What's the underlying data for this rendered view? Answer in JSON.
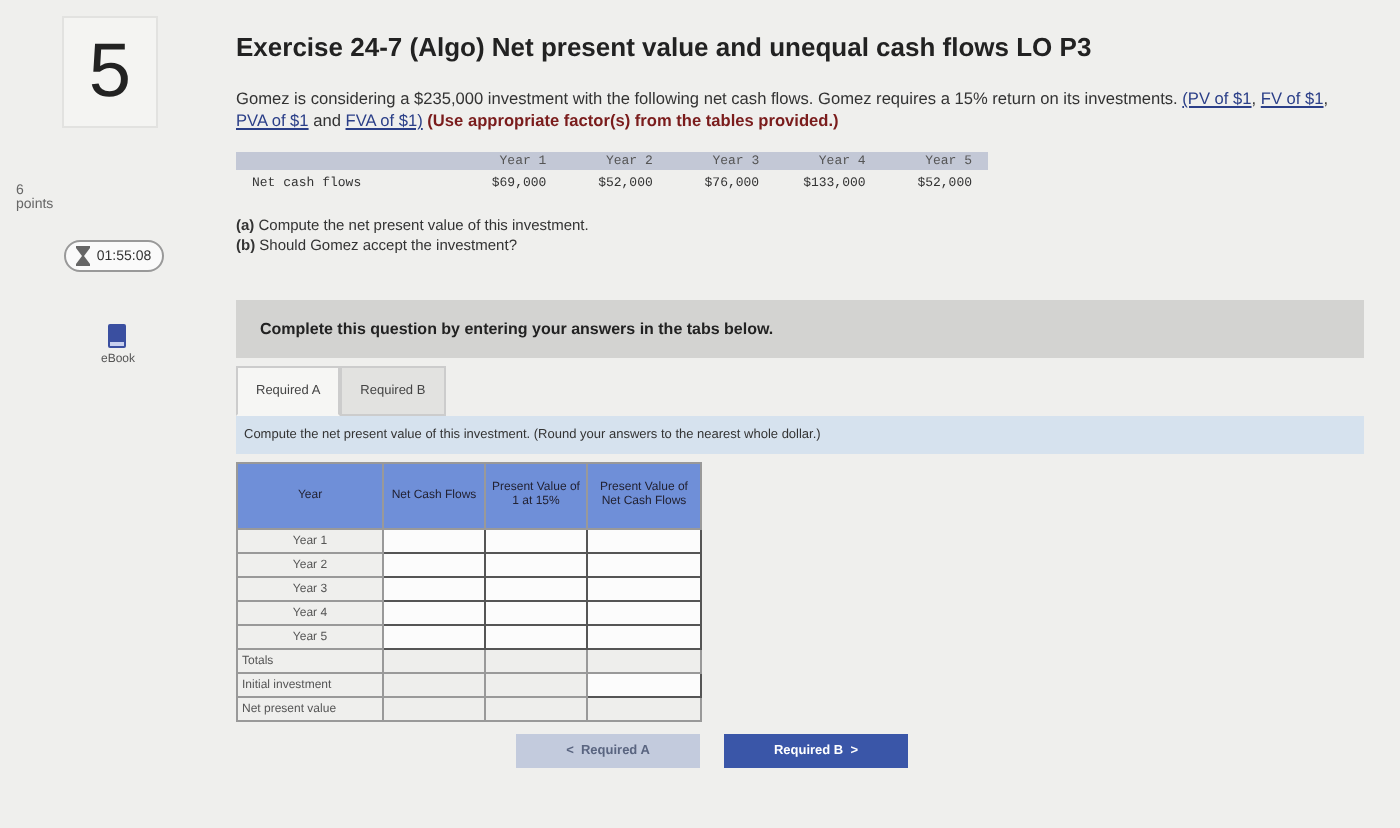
{
  "question": {
    "number": "5",
    "points_value": "6",
    "points_label": "points",
    "timer": "01:55:08",
    "ebook_label": "eBook"
  },
  "title": "Exercise 24-7 (Algo) Net present value and unequal cash flows LO P3",
  "intro": {
    "text": "Gomez is considering a $235,000 investment with the following net cash flows. Gomez requires a 15% return on its investments.",
    "links": [
      "PV of $1",
      "FV of $1",
      "PVA of $1",
      "FVA of $1"
    ],
    "link_sep": ", ",
    "last_sep": " and ",
    "open": "(",
    "close": ")",
    "note": "(Use appropriate factor(s) from the tables provided.)"
  },
  "cash_flows": {
    "row_label": "Net cash flows",
    "years": [
      "Year 1",
      "Year 2",
      "Year 3",
      "Year 4",
      "Year 5"
    ],
    "values": [
      "$69,000",
      "$52,000",
      "$76,000",
      "$133,000",
      "$52,000"
    ]
  },
  "parts": [
    {
      "letter": "(a)",
      "text": "Compute the net present value of this investment."
    },
    {
      "letter": "(b)",
      "text": "Should Gomez accept the investment?"
    }
  ],
  "instruction_bar": "Complete this question by entering your answers in the tabs below.",
  "tabs": [
    {
      "label": "Required A",
      "selected": true
    },
    {
      "label": "Required B",
      "selected": false
    }
  ],
  "task": "Compute the net present value of this investment. (Round your answers to the nearest whole dollar.)",
  "table": {
    "columns": [
      "Year",
      "Net Cash Flows",
      "Present Value of 1 at 15%",
      "Present Value of Net Cash Flows"
    ],
    "rows": [
      {
        "label": "Year 1",
        "kind": "year",
        "cells": [
          {
            "kind": "input"
          },
          {
            "kind": "input"
          },
          {
            "kind": "input"
          }
        ]
      },
      {
        "label": "Year 2",
        "kind": "year",
        "cells": [
          {
            "kind": "input"
          },
          {
            "kind": "input"
          },
          {
            "kind": "input"
          }
        ]
      },
      {
        "label": "Year 3",
        "kind": "year",
        "cells": [
          {
            "kind": "input"
          },
          {
            "kind": "input"
          },
          {
            "kind": "input"
          }
        ]
      },
      {
        "label": "Year 4",
        "kind": "year",
        "cells": [
          {
            "kind": "input"
          },
          {
            "kind": "input"
          },
          {
            "kind": "input"
          }
        ]
      },
      {
        "label": "Year 5",
        "kind": "year",
        "cells": [
          {
            "kind": "input"
          },
          {
            "kind": "input"
          },
          {
            "kind": "input"
          }
        ]
      },
      {
        "label": "Totals",
        "kind": "summary",
        "cells": [
          {
            "kind": "blank"
          },
          {
            "kind": "blank"
          },
          {
            "kind": "blank"
          }
        ]
      },
      {
        "label": "Initial investment",
        "kind": "summary",
        "cells": [
          {
            "kind": "blank"
          },
          {
            "kind": "blank"
          },
          {
            "kind": "input"
          }
        ]
      },
      {
        "label": "Net present value",
        "kind": "summary",
        "cells": [
          {
            "kind": "blank"
          },
          {
            "kind": "blank"
          },
          {
            "kind": "blank"
          }
        ]
      }
    ]
  },
  "nav": [
    {
      "label": "Required A",
      "chevron": "<",
      "kind": "back",
      "disabled": true
    },
    {
      "label": "Required B",
      "chevron": ">",
      "kind": "next",
      "disabled": false
    }
  ]
}
